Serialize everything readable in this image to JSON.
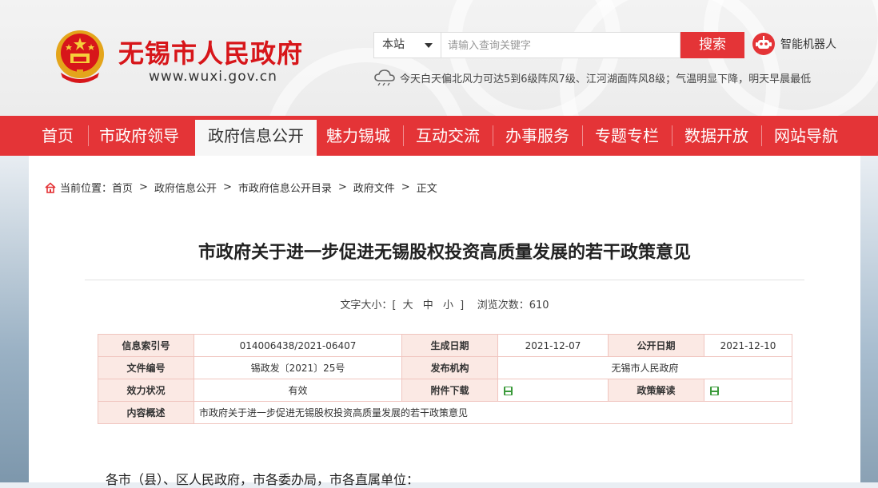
{
  "site": {
    "title": "无锡市人民政府",
    "url": "www.wuxi.gov.cn"
  },
  "search": {
    "scope": "本站",
    "placeholder": "请输入查询关键字",
    "button": "搜索"
  },
  "robot": {
    "label": "智能机器人",
    "icon": "robot-icon"
  },
  "weather": {
    "icon": "weather-cloud-icon",
    "text": "今天白天偏北风力可达5到6级阵风7级、江河湖面阵风8级；气温明显下降，明天早晨最低"
  },
  "nav": {
    "items": [
      {
        "label": "首页"
      },
      {
        "label": "市政府领导"
      },
      {
        "label": "政府信息公开"
      },
      {
        "label": "魅力锡城"
      },
      {
        "label": "互动交流"
      },
      {
        "label": "办事服务"
      },
      {
        "label": "专题专栏"
      },
      {
        "label": "数据开放"
      },
      {
        "label": "网站导航"
      }
    ],
    "active_index": 2
  },
  "breadcrumb": {
    "prefix": "当前位置：",
    "items": [
      "首页",
      "政府信息公开",
      "市政府信息公开目录",
      "政府文件",
      "正文"
    ],
    "separator": ">"
  },
  "article": {
    "title": "市政府关于进一步促进无锡股权投资高质量发展的若干政策意见",
    "font_size_label": "文字大小：[",
    "font_sizes": [
      "大",
      "中",
      "小"
    ],
    "font_size_close": "]",
    "views_label": "浏览次数：",
    "views": "610"
  },
  "info_table": {
    "index_label": "信息索引号",
    "index_value": "014006438/2021-06407",
    "created_label": "生成日期",
    "created_value": "2021-12-07",
    "published_label": "公开日期",
    "published_value": "2021-12-10",
    "doc_no_label": "文件编号",
    "doc_no_value": "锡政发〔2021〕25号",
    "issuer_label": "发布机构",
    "issuer_value": "无锡市人民政府",
    "status_label": "效力状况",
    "status_value": "有效",
    "attachment_label": "附件下载",
    "policy_label": "政策解读",
    "summary_label": "内容概述",
    "summary_value": "市政府关于进一步促进无锡股权投资高质量发展的若干政策意见"
  },
  "body": {
    "first_line": "各市（县）、区人民政府，市各委办局，市各直属单位："
  },
  "colors": {
    "brand_red": "#e43437",
    "title_red": "#d7161a",
    "table_label_bg": "#fbe9e4",
    "table_border": "#f0c5bf",
    "file_green": "#3a9a3a"
  }
}
